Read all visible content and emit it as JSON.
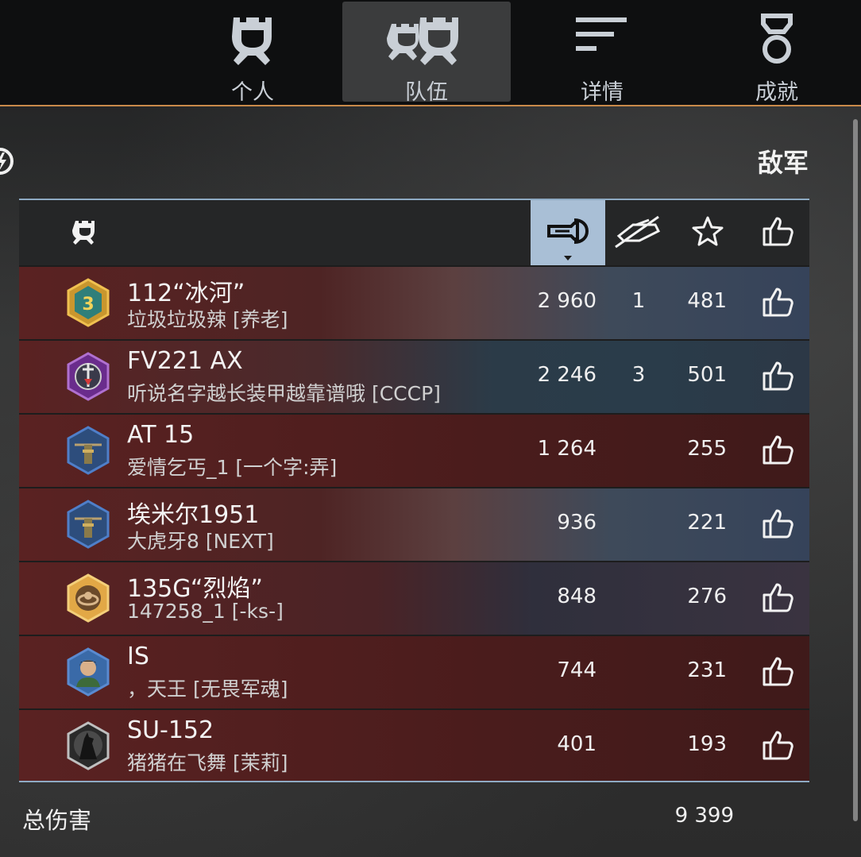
{
  "tabs": [
    {
      "label": "个人",
      "icon": "single-helmet-icon",
      "active": false
    },
    {
      "label": "队伍",
      "icon": "team-helmets-icon",
      "active": true
    },
    {
      "label": "详情",
      "icon": "details-lines-icon",
      "active": false
    },
    {
      "label": "成就",
      "icon": "medal-icon",
      "active": false
    }
  ],
  "side_title": "敌军",
  "table": {
    "header_icons": [
      "player-helmet-icon",
      "damage-shell-icon",
      "kills-icon",
      "experience-star-icon",
      "like-icon"
    ],
    "sorted_column": "damage",
    "rows": [
      {
        "tank": "112“冰河”",
        "player": "垃圾垃圾辣 [养老]",
        "damage": "2 960",
        "kills": "1",
        "xp": "481",
        "badge": "rank-3-badge-icon"
      },
      {
        "tank": "FV221 AX",
        "player": "听说名字越长装甲越靠谱哦 [CCCP]",
        "damage": "2 246",
        "kills": "3",
        "xp": "501",
        "badge": "purple-sword-badge-icon"
      },
      {
        "tank": "AT 15",
        "player": "爱情乞丐_1 [一个字:弄]",
        "damage": "1 264",
        "kills": "",
        "xp": "255",
        "badge": "tank-blue-badge-icon"
      },
      {
        "tank": "埃米尔1951",
        "player": "大虎牙8 [NEXT]",
        "damage": "936",
        "kills": "",
        "xp": "221",
        "badge": "tank-blue-badge-icon"
      },
      {
        "tank": "135G“烈焰”",
        "player": "147258_1 [-ks-]",
        "damage": "848",
        "kills": "",
        "xp": "276",
        "badge": "gold-ring-badge-icon"
      },
      {
        "tank": "IS",
        "player": "，天王 [无畏军魂]",
        "damage": "744",
        "kills": "",
        "xp": "231",
        "badge": "portrait-badge-icon"
      },
      {
        "tank": "SU-152",
        "player": "猪猪在飞舞 [茉莉]",
        "damage": "401",
        "kills": "",
        "xp": "193",
        "badge": "wolf-badge-icon"
      }
    ]
  },
  "footer": {
    "label": "总伤害",
    "value": "9 399"
  },
  "colors": {
    "accent_line": "#c98a4a",
    "table_border": "#8eaac3",
    "row_red": "#5a2222",
    "sorted_header": "#a9bfd6"
  }
}
